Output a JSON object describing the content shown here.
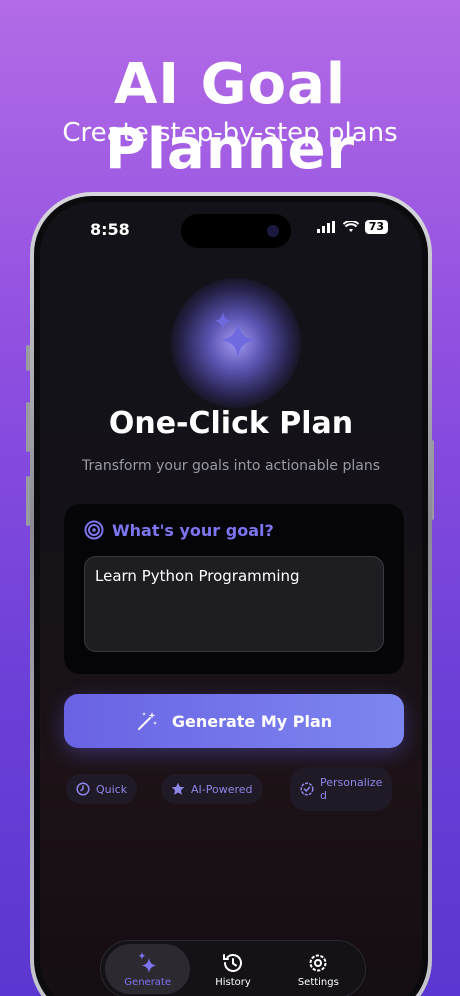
{
  "promo": {
    "title": "AI Goal Planner",
    "subtitle": "Create step-by-step plans"
  },
  "status_bar": {
    "time": "8:58",
    "battery": "73"
  },
  "main": {
    "title": "One-Click Plan",
    "subtitle": "Transform your goals into actionable plans",
    "goal_label": "What's your goal?",
    "goal_value": "Learn Python Programming",
    "generate_label": "Generate My Plan"
  },
  "chips": [
    {
      "label": "Quick",
      "icon": "clock-icon"
    },
    {
      "label": "AI-Powered",
      "icon": "star-icon"
    },
    {
      "label_line1": "Personalize",
      "label_line2": "d",
      "icon": "badge-check-icon"
    }
  ],
  "tabs": [
    {
      "label": "Generate",
      "icon": "sparkles-icon",
      "active": true
    },
    {
      "label": "History",
      "icon": "history-icon",
      "active": false
    },
    {
      "label": "Settings",
      "icon": "gear-icon",
      "active": false
    }
  ],
  "colors": {
    "accent": "#7d74f0",
    "background_top": "#b36be6",
    "background_bottom": "#5a37d0"
  }
}
